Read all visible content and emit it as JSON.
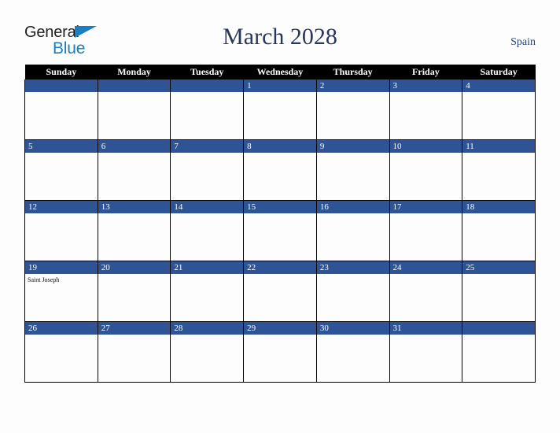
{
  "brand": {
    "name_part1": "General",
    "name_part2": "Blue",
    "triangle_icon": "triangle-icon",
    "color_dark": "#231f20",
    "color_blue": "#1a7ec0"
  },
  "header": {
    "title": "March 2028",
    "region": "Spain",
    "title_color": "#28375e"
  },
  "theme": {
    "header_row_bg": "#000000",
    "day_band_bg": "#2e5496",
    "cell_bg": "#fdfdfd",
    "border": "#000000",
    "page_bg": "#fdfdfd"
  },
  "weekday_headers": [
    "Sunday",
    "Monday",
    "Tuesday",
    "Wednesday",
    "Thursday",
    "Friday",
    "Saturday"
  ],
  "weeks": [
    [
      {
        "day": "",
        "events": []
      },
      {
        "day": "",
        "events": []
      },
      {
        "day": "",
        "events": []
      },
      {
        "day": "1",
        "events": []
      },
      {
        "day": "2",
        "events": []
      },
      {
        "day": "3",
        "events": []
      },
      {
        "day": "4",
        "events": []
      }
    ],
    [
      {
        "day": "5",
        "events": []
      },
      {
        "day": "6",
        "events": []
      },
      {
        "day": "7",
        "events": []
      },
      {
        "day": "8",
        "events": []
      },
      {
        "day": "9",
        "events": []
      },
      {
        "day": "10",
        "events": []
      },
      {
        "day": "11",
        "events": []
      }
    ],
    [
      {
        "day": "12",
        "events": []
      },
      {
        "day": "13",
        "events": []
      },
      {
        "day": "14",
        "events": []
      },
      {
        "day": "15",
        "events": []
      },
      {
        "day": "16",
        "events": []
      },
      {
        "day": "17",
        "events": []
      },
      {
        "day": "18",
        "events": []
      }
    ],
    [
      {
        "day": "19",
        "events": [
          "Saint Joseph"
        ]
      },
      {
        "day": "20",
        "events": []
      },
      {
        "day": "21",
        "events": []
      },
      {
        "day": "22",
        "events": []
      },
      {
        "day": "23",
        "events": []
      },
      {
        "day": "24",
        "events": []
      },
      {
        "day": "25",
        "events": []
      }
    ],
    [
      {
        "day": "26",
        "events": []
      },
      {
        "day": "27",
        "events": []
      },
      {
        "day": "28",
        "events": []
      },
      {
        "day": "29",
        "events": []
      },
      {
        "day": "30",
        "events": []
      },
      {
        "day": "31",
        "events": []
      },
      {
        "day": "",
        "events": []
      }
    ]
  ]
}
